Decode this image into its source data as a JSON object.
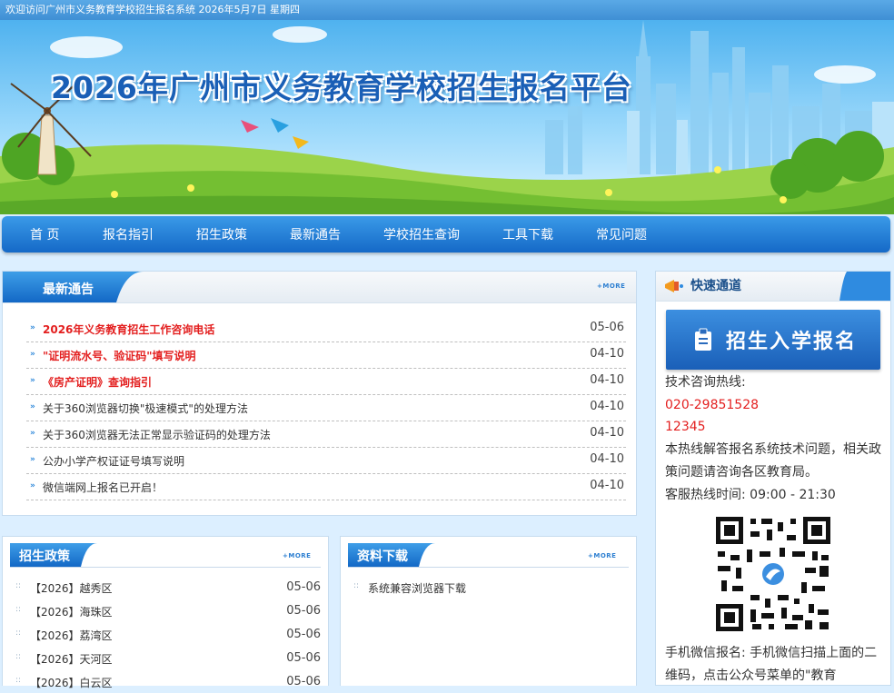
{
  "topbar": {
    "text": "欢迎访问广州市义务教育学校招生报名系统 2026年5月7日 星期四"
  },
  "banner": {
    "title": "2026年广州市义务教育学校招生报名平台"
  },
  "nav": [
    {
      "label": "首 页"
    },
    {
      "label": "报名指引"
    },
    {
      "label": "招生政策"
    },
    {
      "label": "最新通告"
    },
    {
      "label": "学校招生查询"
    },
    {
      "label": "工具下载"
    },
    {
      "label": "常见问题"
    }
  ],
  "more_label": "+MORE",
  "notices": {
    "title": "最新通告",
    "items": [
      {
        "title": "2026年义务教育招生工作咨询电话",
        "date": "05-06",
        "hot": true
      },
      {
        "title": "\"证明流水号、验证码\"填写说明",
        "date": "04-10",
        "hot": true
      },
      {
        "title": "《房产证明》查询指引",
        "date": "04-10",
        "hot": true
      },
      {
        "title": "关于360浏览器切换\"极速模式\"的处理方法",
        "date": "04-10",
        "hot": false
      },
      {
        "title": "关于360浏览器无法正常显示验证码的处理方法",
        "date": "04-10",
        "hot": false
      },
      {
        "title": "公办小学产权证证号填写说明",
        "date": "04-10",
        "hot": false
      },
      {
        "title": "微信端网上报名已开启！",
        "date": "04-10",
        "hot": false
      }
    ]
  },
  "policy": {
    "title": "招生政策",
    "items": [
      {
        "title": "【2026】越秀区",
        "date": "05-06"
      },
      {
        "title": "【2026】海珠区",
        "date": "05-06"
      },
      {
        "title": "【2026】荔湾区",
        "date": "05-06"
      },
      {
        "title": "【2026】天河区",
        "date": "05-06"
      },
      {
        "title": "【2026】白云区",
        "date": "05-06"
      }
    ]
  },
  "downloads": {
    "title": "资料下载",
    "items": [
      {
        "title": "系统兼容浏览器下载"
      }
    ]
  },
  "quick": {
    "title": "快速通道",
    "register_label": "招生入学报名",
    "hotline_label": "技术咨询热线:",
    "phone1": "020-29851528",
    "phone2": "12345",
    "hotline_note": "本热线解答报名系统技术问题，相关政策问题请咨询各区教育局。",
    "hours": "客服热线时间: 09:00 - 21:30",
    "wechat_note": "手机微信报名: 手机微信扫描上面的二维码，点击公众号菜单的\"教育"
  },
  "colors": {
    "brand_blue": "#1a6fd0",
    "hot_red": "#e31f1f",
    "page_bg": "#dcefff"
  }
}
